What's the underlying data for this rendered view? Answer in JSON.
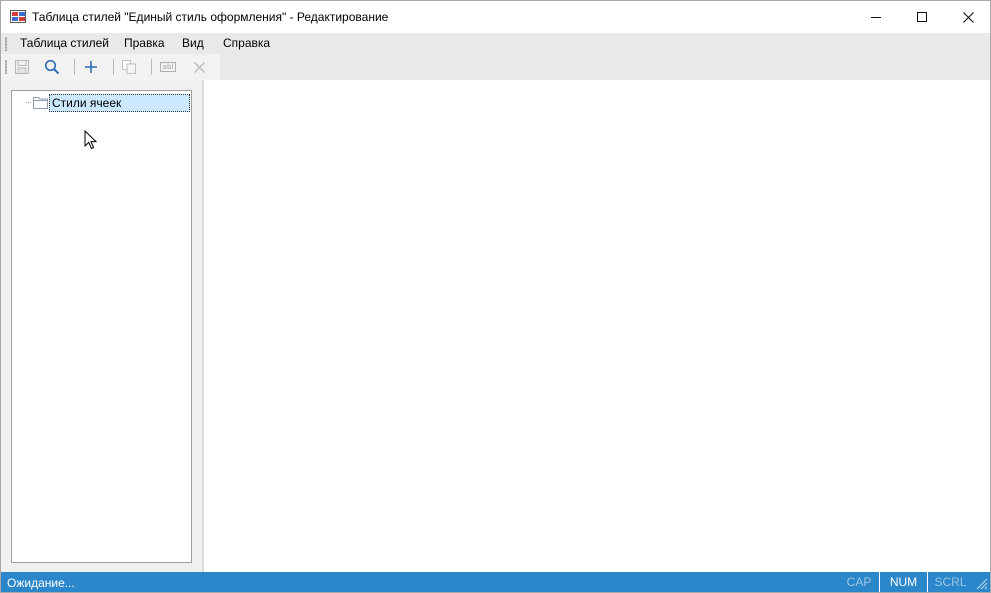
{
  "window": {
    "title": "Таблица стилей \"Единый стиль оформления\" - Редактирование",
    "icon": "stylesheet-app-icon",
    "controls": [
      "minimize-icon",
      "maximize-icon",
      "close-icon"
    ]
  },
  "menu": {
    "items": [
      {
        "label": "Таблица стилей"
      },
      {
        "label": "Правка"
      },
      {
        "label": "Вид"
      },
      {
        "label": "Справка"
      }
    ]
  },
  "toolbar": {
    "buttons": [
      {
        "icon": "save-icon",
        "enabled": false
      },
      {
        "icon": "search-icon",
        "enabled": true
      },
      {
        "icon": "plus-icon",
        "enabled": true
      },
      {
        "icon": "copy-icon",
        "enabled": false
      },
      {
        "icon": "rename-icon",
        "label": "abl",
        "enabled": false
      },
      {
        "icon": "delete-icon",
        "enabled": false
      }
    ]
  },
  "tree": {
    "items": [
      {
        "label": "Стили ячеек",
        "icon": "folder-icon",
        "selected": true
      }
    ]
  },
  "status": {
    "text": "Ожидание...",
    "indicators": {
      "cap": "CAP",
      "num": "NUM",
      "scrl": "SCRL"
    }
  },
  "colors": {
    "statusbar": "#2b87c9",
    "selection": "#cce8ff",
    "accent_icon": "#2f6db5"
  }
}
